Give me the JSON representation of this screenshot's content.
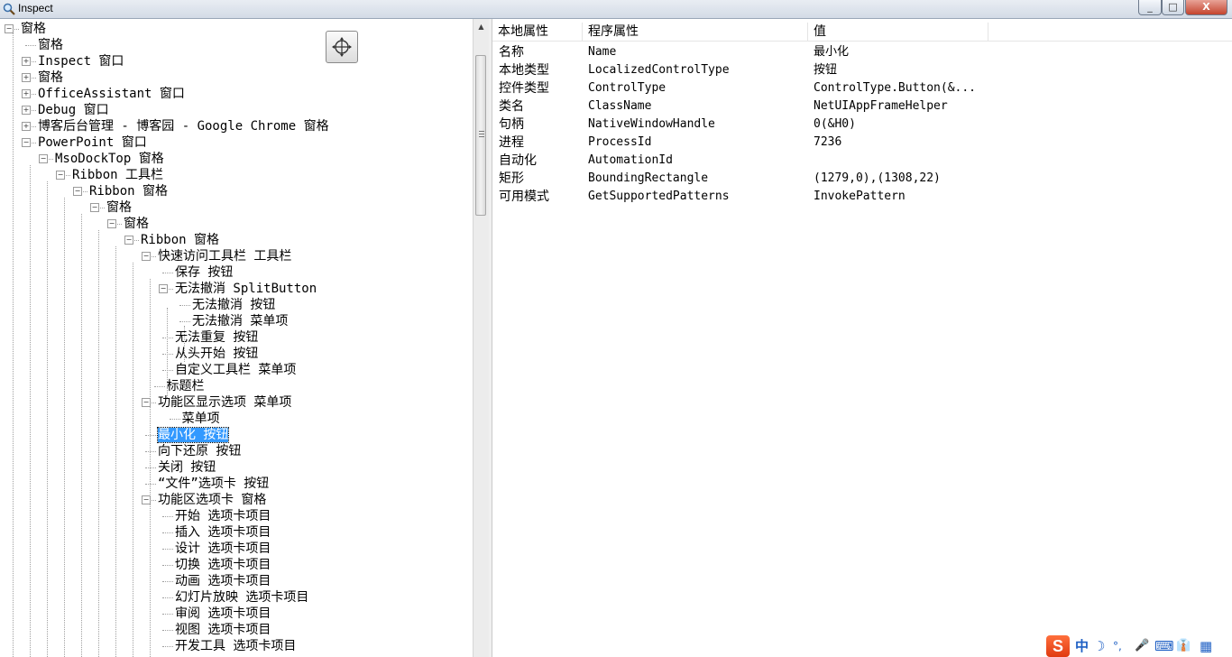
{
  "window": {
    "title": "Inspect",
    "minimize": "_",
    "maximize": "□",
    "close": "X"
  },
  "tree": [
    {
      "label": "窗格",
      "level": 0,
      "exp": "-"
    },
    {
      "label": "窗格",
      "level": 1,
      "exp": ""
    },
    {
      "label": "Inspect 窗口",
      "level": 1,
      "exp": "+"
    },
    {
      "label": "窗格",
      "level": 1,
      "exp": "+"
    },
    {
      "label": "OfficeAssistant 窗口",
      "level": 1,
      "exp": "+"
    },
    {
      "label": "Debug 窗口",
      "level": 1,
      "exp": "+"
    },
    {
      "label": "博客后台管理 - 博客园 - Google Chrome 窗格",
      "level": 1,
      "exp": "+"
    },
    {
      "label": "PowerPoint 窗口",
      "level": 1,
      "exp": "-"
    },
    {
      "label": "MsoDockTop 窗格",
      "level": 2,
      "exp": "-"
    },
    {
      "label": "Ribbon 工具栏",
      "level": 3,
      "exp": "-"
    },
    {
      "label": "Ribbon 窗格",
      "level": 4,
      "exp": "-"
    },
    {
      "label": "窗格",
      "level": 5,
      "exp": "-"
    },
    {
      "label": "窗格",
      "level": 6,
      "exp": "-"
    },
    {
      "label": "Ribbon 窗格",
      "level": 7,
      "exp": "-"
    },
    {
      "label": "快速访问工具栏 工具栏",
      "level": 8,
      "exp": "-"
    },
    {
      "label": "保存 按钮",
      "level": 9,
      "exp": ""
    },
    {
      "label": "无法撤消 SplitButton",
      "level": 9,
      "exp": "-"
    },
    {
      "label": "无法撤消 按钮",
      "level": 10,
      "exp": ""
    },
    {
      "label": "无法撤消 菜单项",
      "level": 10,
      "exp": ""
    },
    {
      "label": "无法重复 按钮",
      "level": 9,
      "exp": ""
    },
    {
      "label": "从头开始 按钮",
      "level": 9,
      "exp": ""
    },
    {
      "label": "自定义工具栏 菜单项",
      "level": 9,
      "exp": ""
    },
    {
      "label": "标题栏",
      "level": 8.5,
      "exp": ""
    },
    {
      "label": "功能区显示选项 菜单项",
      "level": 8,
      "exp": "-"
    },
    {
      "label": "菜单项",
      "level": 9.4,
      "exp": ""
    },
    {
      "label": "最小化 按钮",
      "level": 8,
      "exp": "",
      "selected": true
    },
    {
      "label": "向下还原 按钮",
      "level": 8,
      "exp": ""
    },
    {
      "label": "关闭 按钮",
      "level": 8,
      "exp": ""
    },
    {
      "label": "“文件”选项卡 按钮",
      "level": 8,
      "exp": ""
    },
    {
      "label": "功能区选项卡 窗格",
      "level": 8,
      "exp": "-"
    },
    {
      "label": "开始 选项卡项目",
      "level": 9,
      "exp": ""
    },
    {
      "label": "插入 选项卡项目",
      "level": 9,
      "exp": ""
    },
    {
      "label": "设计 选项卡项目",
      "level": 9,
      "exp": ""
    },
    {
      "label": "切换 选项卡项目",
      "level": 9,
      "exp": ""
    },
    {
      "label": "动画 选项卡项目",
      "level": 9,
      "exp": ""
    },
    {
      "label": "幻灯片放映 选项卡项目",
      "level": 9,
      "exp": ""
    },
    {
      "label": "审阅 选项卡项目",
      "level": 9,
      "exp": ""
    },
    {
      "label": "视图 选项卡项目",
      "level": 9,
      "exp": ""
    },
    {
      "label": "开发工具 选项卡项目",
      "level": 9,
      "exp": ""
    }
  ],
  "properties": {
    "headers": [
      "本地属性",
      "程序属性",
      "值"
    ],
    "rows": [
      {
        "local": "名称",
        "program": "Name",
        "value": "最小化"
      },
      {
        "local": "本地类型",
        "program": "LocalizedControlType",
        "value": "按钮"
      },
      {
        "local": "控件类型",
        "program": "ControlType",
        "value": "ControlType.Button(&..."
      },
      {
        "local": "类名",
        "program": "ClassName",
        "value": "NetUIAppFrameHelper"
      },
      {
        "local": "句柄",
        "program": "NativeWindowHandle",
        "value": "0(&H0)"
      },
      {
        "local": "进程",
        "program": "ProcessId",
        "value": "7236"
      },
      {
        "local": "自动化",
        "program": "AutomationId",
        "value": ""
      },
      {
        "local": "矩形",
        "program": "BoundingRectangle",
        "value": "(1279,0),(1308,22)"
      },
      {
        "local": "可用模式",
        "program": "GetSupportedPatterns",
        "value": "InvokePattern"
      }
    ]
  },
  "tray": {
    "ime": "S",
    "lang": "中",
    "moon": "☽",
    "punct": "°,",
    "mic": "🎤",
    "keyboard": "⌨",
    "skin": "👔",
    "tools": "▦"
  }
}
